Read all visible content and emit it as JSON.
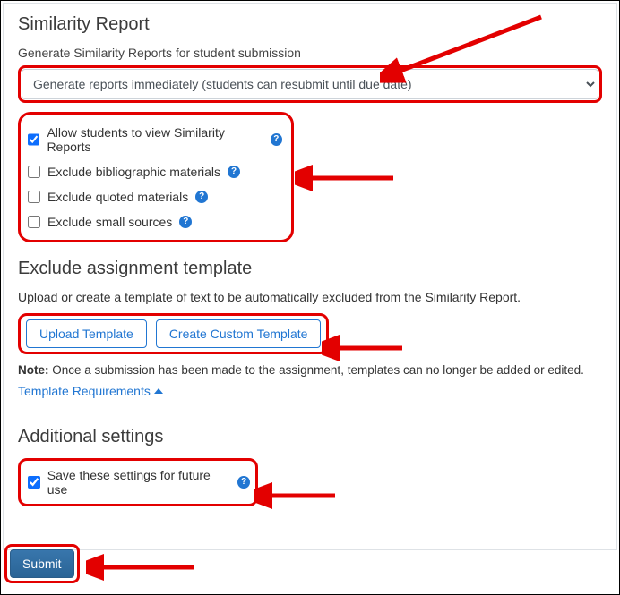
{
  "similarity": {
    "title": "Similarity Report",
    "generate_label": "Generate Similarity Reports for student submission",
    "select_value": "Generate reports immediately (students can resubmit until due date)",
    "checkboxes": {
      "allow_view": {
        "label": "Allow students to view Similarity Reports",
        "checked": true
      },
      "exclude_biblio": {
        "label": "Exclude bibliographic materials",
        "checked": false
      },
      "exclude_quoted": {
        "label": "Exclude quoted materials",
        "checked": false
      },
      "exclude_small": {
        "label": "Exclude small sources",
        "checked": false
      }
    }
  },
  "template": {
    "title": "Exclude assignment template",
    "desc": "Upload or create a template of text to be automatically excluded from the Similarity Report.",
    "upload_label": "Upload Template",
    "create_label": "Create Custom Template",
    "note_bold": "Note:",
    "note_text": " Once a submission has been made to the assignment, templates can no longer be added or edited.",
    "req_link": "Template Requirements"
  },
  "additional": {
    "title": "Additional settings",
    "save_label": "Save these settings for future use",
    "save_checked": true
  },
  "footer": {
    "submit_label": "Submit"
  }
}
